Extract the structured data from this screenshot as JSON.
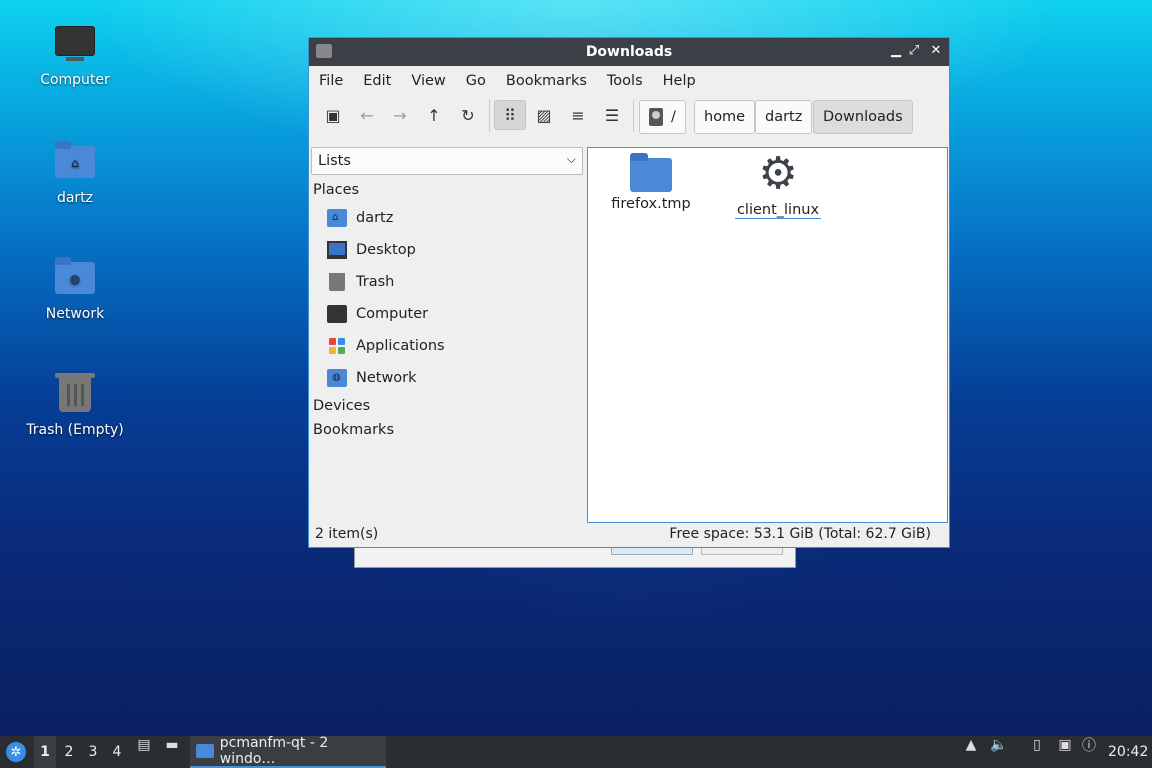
{
  "desktop": {
    "icons": [
      {
        "label": "Computer"
      },
      {
        "label": "dartz"
      },
      {
        "label": "Network"
      },
      {
        "label": "Trash (Empty)"
      }
    ]
  },
  "window": {
    "title": "Downloads",
    "controls": {
      "minimize": "▁",
      "maximize": "⤢",
      "close": "✕"
    },
    "menu": [
      "File",
      "Edit",
      "View",
      "Go",
      "Bookmarks",
      "Tools",
      "Help"
    ],
    "toolbar": {
      "new_tab": "▣",
      "back": "←",
      "forward": "→",
      "up": "↑",
      "reload": "↻",
      "icon_view": "⠿",
      "thumb_view": "▨",
      "compact_view": "≡",
      "detail_view": "☰"
    },
    "path": [
      "/",
      "home",
      "dartz",
      "Downloads"
    ],
    "side_pane_mode": "Lists",
    "sidebar": {
      "places_header": "Places",
      "places": [
        {
          "label": "dartz",
          "icon": "home-folder-icon"
        },
        {
          "label": "Desktop",
          "icon": "desktop-icon"
        },
        {
          "label": "Trash",
          "icon": "trash-icon"
        },
        {
          "label": "Computer",
          "icon": "computer-icon"
        },
        {
          "label": "Applications",
          "icon": "applications-icon"
        },
        {
          "label": "Network",
          "icon": "network-folder-icon"
        }
      ],
      "devices_header": "Devices",
      "bookmarks_header": "Bookmarks"
    },
    "files": [
      {
        "name": "firefox.tmp",
        "icon": "folder-icon"
      },
      {
        "name": "client_linux",
        "icon": "executable-gear-icon"
      }
    ],
    "status": {
      "count": "2 item(s)",
      "space": "Free space: 53.1 GiB (Total: 62.7 GiB)"
    }
  },
  "taskbar": {
    "workspaces": [
      "1",
      "2",
      "3",
      "4"
    ],
    "app_title": "pcmanfm-qt - 2 windo…",
    "clock": "20:42"
  },
  "colors": {
    "accent": "#4a90d9",
    "titlebar": "#3c3f45",
    "taskbar": "#2a2d31"
  }
}
